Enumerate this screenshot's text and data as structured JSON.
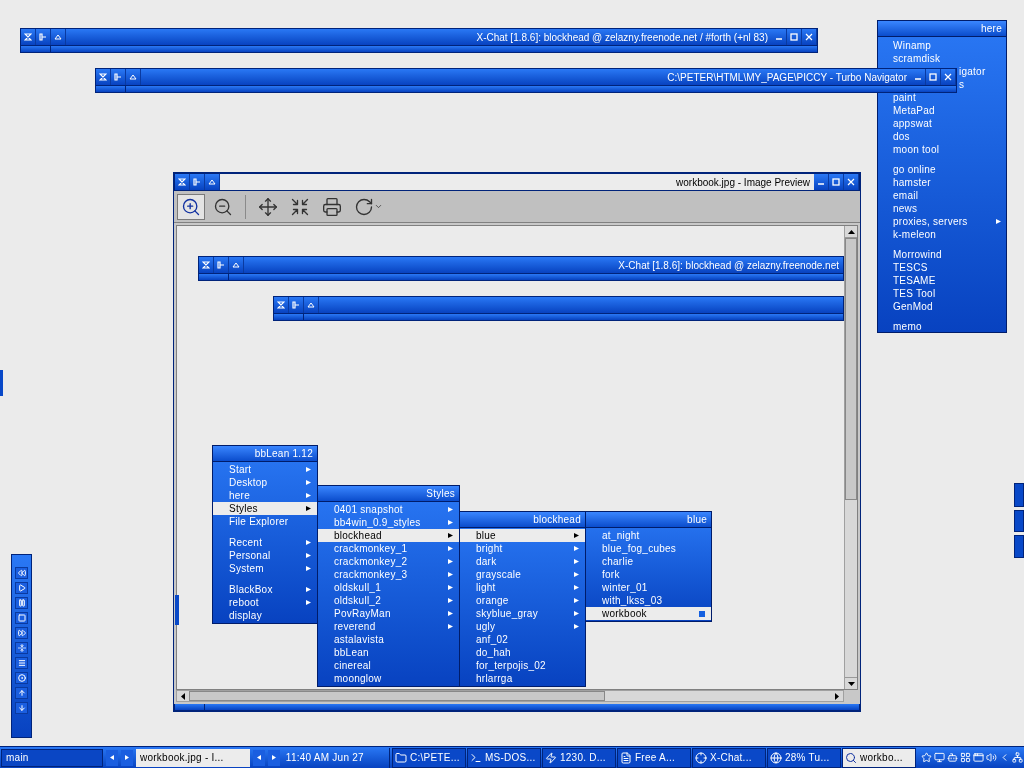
{
  "windows": [
    {
      "title": "X-Chat [1.8.6]: blockhead @ zelazny.freenode.net / #forth (+nl 83)",
      "focused": false,
      "controls": true
    },
    {
      "title": "C:\\PETER\\HTML\\MY_PAGE\\PICCY - Turbo Navigator",
      "focused": false,
      "controls": true
    }
  ],
  "here_menu": {
    "title": "here",
    "groups": [
      [
        {
          "label": "Winamp",
          "kind": "item"
        },
        {
          "label": "scramdisk",
          "kind": "item"
        },
        {
          "label": "igator",
          "kind": "partial"
        },
        {
          "label": "s",
          "kind": "partial"
        },
        {
          "label": "paint",
          "kind": "item"
        },
        {
          "label": "MetaPad",
          "kind": "item"
        },
        {
          "label": "appswat",
          "kind": "item"
        },
        {
          "label": "dos",
          "kind": "item"
        },
        {
          "label": "moon tool",
          "kind": "item"
        }
      ],
      [
        {
          "label": "go online",
          "kind": "item"
        },
        {
          "label": "hamster",
          "kind": "item"
        },
        {
          "label": "email",
          "kind": "item"
        },
        {
          "label": "news",
          "kind": "item"
        },
        {
          "label": "proxies, servers",
          "kind": "submenu"
        },
        {
          "label": "k-meleon",
          "kind": "item"
        }
      ],
      [
        {
          "label": "Morrowind",
          "kind": "item"
        },
        {
          "label": "TESCS",
          "kind": "item"
        },
        {
          "label": "TESAME",
          "kind": "item"
        },
        {
          "label": "TES Tool",
          "kind": "item"
        },
        {
          "label": "GenMod",
          "kind": "item"
        }
      ],
      [
        {
          "label": "memo",
          "kind": "item"
        }
      ]
    ]
  },
  "preview": {
    "title": "workbook.jpg - Image Preview",
    "focused": true,
    "controls": true,
    "toolbar": [
      {
        "kind": "zoom_in",
        "selected": true
      },
      {
        "kind": "zoom_out",
        "selected": false
      },
      {
        "kind": "separator"
      },
      {
        "kind": "fit",
        "selected": false
      },
      {
        "kind": "shrink",
        "selected": false
      },
      {
        "kind": "print",
        "selected": false
      },
      {
        "kind": "rotate",
        "selected": false
      }
    ]
  },
  "inner_windows": [
    {
      "title": "X-Chat [1.8.6]: blockhead @ zelazny.freenode.net",
      "focused": false,
      "controls": false
    },
    {
      "focused": false,
      "controls": false
    }
  ],
  "menus": [
    {
      "title": "bbLean 1.12",
      "groups": [
        [
          {
            "label": "Start",
            "submenu": true,
            "selected": false
          },
          {
            "label": "Desktop",
            "submenu": true,
            "selected": false
          },
          {
            "label": "here",
            "submenu": true,
            "selected": false
          },
          {
            "label": "Styles",
            "submenu": true,
            "selected": true
          },
          {
            "label": "File Explorer",
            "submenu": false,
            "selected": false
          }
        ],
        [
          {
            "label": "Recent",
            "submenu": true,
            "selected": false
          },
          {
            "label": "Personal",
            "submenu": true,
            "selected": false
          },
          {
            "label": "System",
            "submenu": true,
            "selected": false
          }
        ],
        [
          {
            "label": "BlackBox",
            "submenu": true,
            "selected": false
          },
          {
            "label": "reboot",
            "submenu": true,
            "selected": false
          },
          {
            "label": "display",
            "submenu": false,
            "selected": false
          }
        ]
      ]
    },
    {
      "title": "Styles",
      "items": [
        {
          "label": "0401 snapshot",
          "submenu": true,
          "selected": false
        },
        {
          "label": "bb4win_0.9_styles",
          "submenu": true,
          "selected": false
        },
        {
          "label": "blockhead",
          "submenu": true,
          "selected": true
        },
        {
          "label": "crackmonkey_1",
          "submenu": true,
          "selected": false
        },
        {
          "label": "crackmonkey_2",
          "submenu": true,
          "selected": false
        },
        {
          "label": "crackmonkey_3",
          "submenu": true,
          "selected": false
        },
        {
          "label": "oldskull_1",
          "submenu": true,
          "selected": false
        },
        {
          "label": "oldskull_2",
          "submenu": true,
          "selected": false
        },
        {
          "label": "PovRayMan",
          "submenu": true,
          "selected": false
        },
        {
          "label": "reverend",
          "submenu": true,
          "selected": false
        },
        {
          "label": "astalavista",
          "submenu": false,
          "selected": false
        },
        {
          "label": "bbLean",
          "submenu": false,
          "selected": false
        },
        {
          "label": "cinereal",
          "submenu": false,
          "selected": false
        },
        {
          "label": "moonglow",
          "submenu": false,
          "selected": false
        }
      ]
    },
    {
      "title": "blockhead",
      "items": [
        {
          "label": "blue",
          "submenu": true,
          "selected": true
        },
        {
          "label": "bright",
          "submenu": true,
          "selected": false
        },
        {
          "label": "dark",
          "submenu": true,
          "selected": false
        },
        {
          "label": "grayscale",
          "submenu": true,
          "selected": false
        },
        {
          "label": "light",
          "submenu": true,
          "selected": false
        },
        {
          "label": "orange",
          "submenu": true,
          "selected": false
        },
        {
          "label": "skyblue_gray",
          "submenu": true,
          "selected": false
        },
        {
          "label": "ugly",
          "submenu": true,
          "selected": false
        },
        {
          "label": "anf_02",
          "submenu": false,
          "selected": false
        },
        {
          "label": "do_hah",
          "submenu": false,
          "selected": false
        },
        {
          "label": "for_terpojis_02",
          "submenu": false,
          "selected": false
        },
        {
          "label": "hrlarrga",
          "submenu": false,
          "selected": false
        }
      ]
    },
    {
      "title": "blue",
      "items": [
        {
          "label": "at_night",
          "submenu": false,
          "selected": false,
          "checked": false
        },
        {
          "label": "blue_fog_cubes",
          "submenu": false,
          "selected": false,
          "checked": false
        },
        {
          "label": "charlie",
          "submenu": false,
          "selected": false,
          "checked": false
        },
        {
          "label": "fork",
          "submenu": false,
          "selected": false,
          "checked": false
        },
        {
          "label": "winter_01",
          "submenu": false,
          "selected": false,
          "checked": false
        },
        {
          "label": "with_lkss_03",
          "submenu": false,
          "selected": false,
          "checked": false
        },
        {
          "label": "workbook",
          "submenu": false,
          "selected": true,
          "checked": true
        }
      ]
    }
  ],
  "taskbar": {
    "workspace": "main",
    "window_label": "workbook.jpg - I...",
    "clock": "11:40 AM Jun 27",
    "tasks": [
      {
        "label": "C:\\PETE...",
        "kind": "folder",
        "selected": false
      },
      {
        "label": "MS-DOS...",
        "kind": "dos",
        "selected": false
      },
      {
        "label": "1230. D...",
        "kind": "bolt",
        "selected": false
      },
      {
        "label": "Free A...",
        "kind": "doc",
        "selected": false
      },
      {
        "label": "X-Chat...",
        "kind": "chat",
        "selected": false
      },
      {
        "label": "28% Tu...",
        "kind": "globe",
        "selected": false
      },
      {
        "label": "workbo...",
        "kind": "search",
        "selected": true
      }
    ]
  }
}
